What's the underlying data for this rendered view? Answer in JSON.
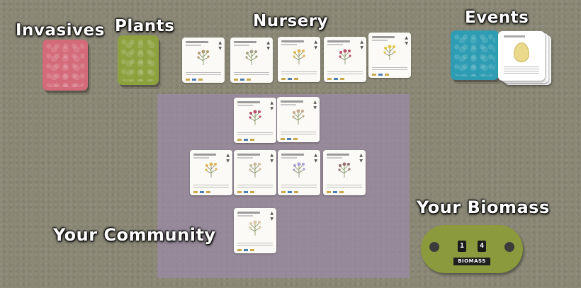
{
  "labels": {
    "invasives": "Invasives",
    "plants": "Plants",
    "nursery": "Nursery",
    "events": "Events",
    "your_community": "Your Community",
    "your_biomass": "Your Biomass"
  },
  "biomass_tracker": {
    "digit_1": "1",
    "digit_2": "4",
    "label": "BIOMASS"
  },
  "colors": {
    "invasives_deck": "#d46b7b",
    "plants_deck": "#8da13f",
    "events_deck": "#2e9db3",
    "community_zone": "#9b8aa8",
    "table": "#8a8775"
  },
  "nursery_cards": [
    {
      "plant_color": "#b39a73"
    },
    {
      "plant_color": "#a8a186"
    },
    {
      "plant_color": "#e0b65a"
    },
    {
      "plant_color": "#b8506a"
    },
    {
      "plant_color": "#e6c64a"
    }
  ],
  "community_cards": [
    {
      "plant_color": "#b8506a"
    },
    {
      "plant_color": "#c7a98f"
    },
    {
      "plant_color": "#e0b65a"
    },
    {
      "plant_color": "#c9bba0"
    },
    {
      "plant_color": "#a8a0cf"
    },
    {
      "plant_color": "#9a6f73"
    },
    {
      "plant_color": "#d8c7a8"
    }
  ]
}
